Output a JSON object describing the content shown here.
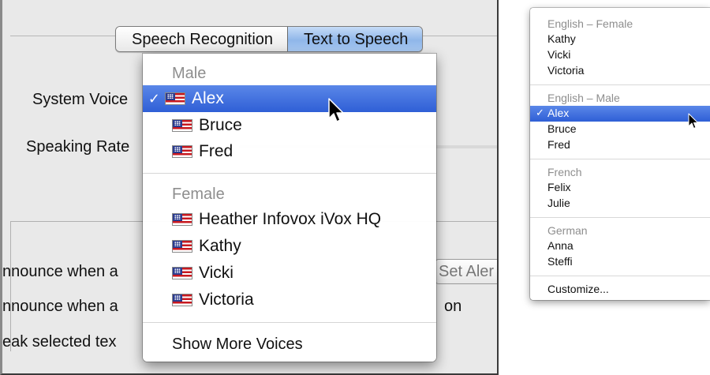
{
  "left_window": {
    "tabs": [
      "Speech Recognition",
      "Text to Speech"
    ],
    "selected_tab": "Text to Speech",
    "system_voice_label": "System Voice",
    "speaking_rate_label": "Speaking Rate",
    "announce_1": "nnounce when a",
    "announce_2": "nnounce when a",
    "speak_selected": "eak selected tex",
    "set_alert_button": "Set Aler",
    "behind_on": "on"
  },
  "voice_menu": {
    "male_header": "Male",
    "male_voices": [
      "Alex",
      "Bruce",
      "Fred"
    ],
    "selected_voice": "Alex",
    "female_header": "Female",
    "female_voices": [
      "Heather Infovox iVox HQ",
      "Kathy",
      "Vicki",
      "Victoria"
    ],
    "show_more": "Show More Voices",
    "checkmark": "✓"
  },
  "small_menu": {
    "groups": [
      {
        "header": "English – Female",
        "items": [
          "Kathy",
          "Vicki",
          "Victoria"
        ]
      },
      {
        "header": "English – Male",
        "items": [
          "Alex",
          "Bruce",
          "Fred"
        ]
      },
      {
        "header": "French",
        "items": [
          "Felix",
          "Julie"
        ]
      },
      {
        "header": "German",
        "items": [
          "Anna",
          "Steffi"
        ]
      }
    ],
    "selected": "Alex",
    "customize": "Customize...",
    "checkmark": "✓"
  },
  "icons": {
    "flag": "us-flag-icon",
    "pointer": "arrow-cursor-icon"
  }
}
